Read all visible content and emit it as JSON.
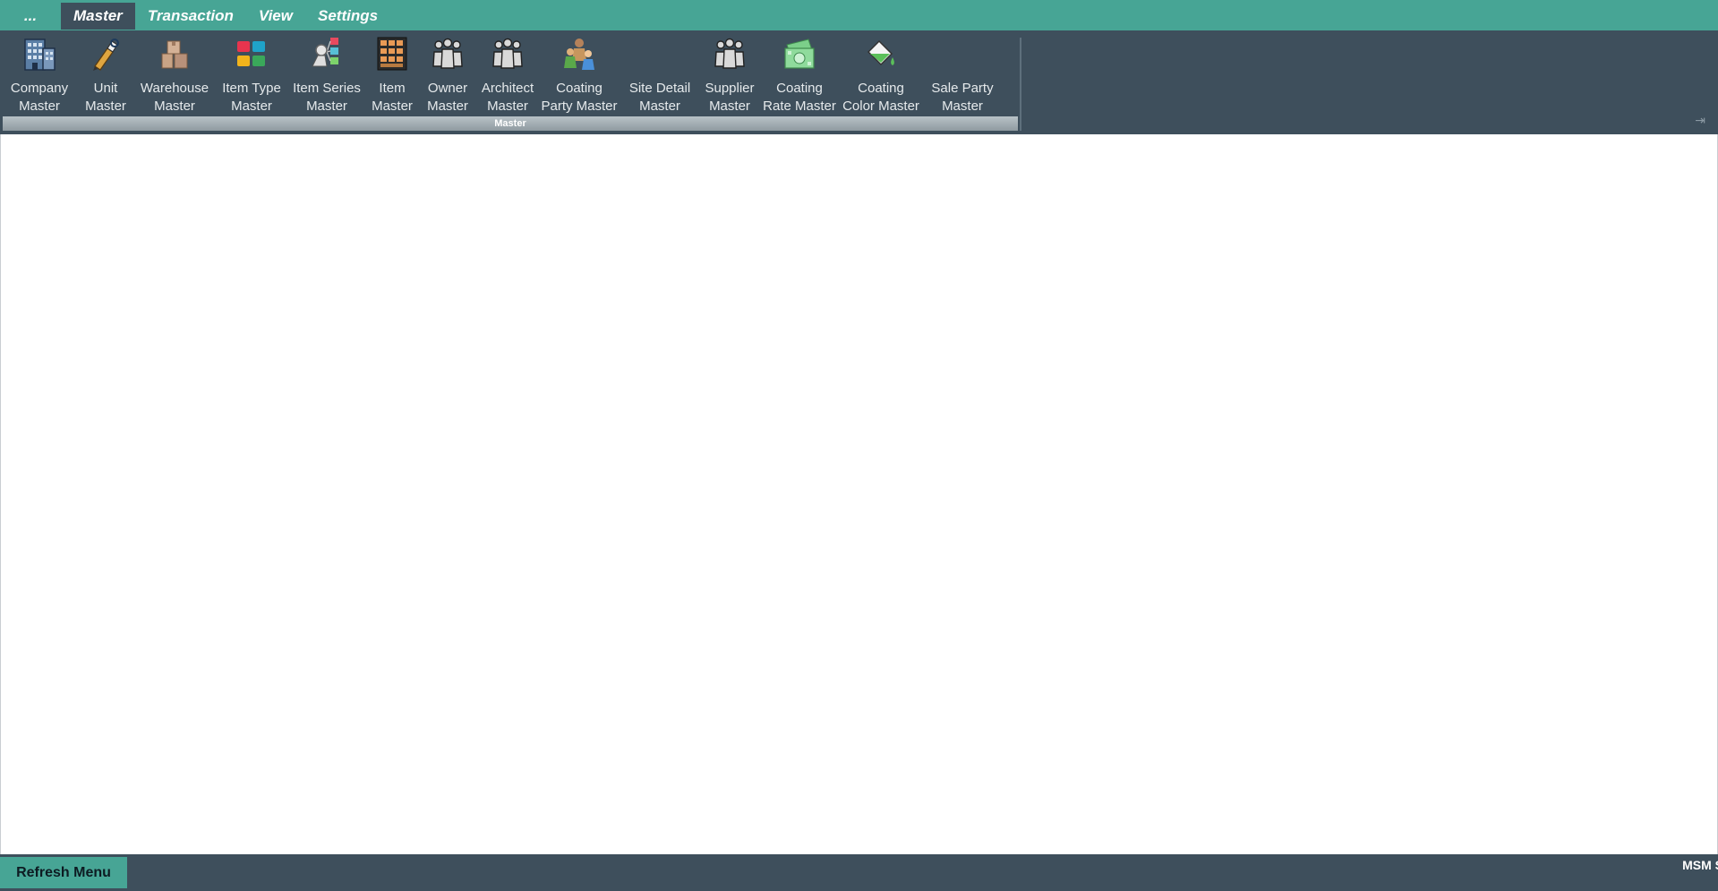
{
  "tabs": [
    {
      "label": "...",
      "name": "tab-app-menu"
    },
    {
      "label": "Master",
      "name": "tab-master",
      "active": true
    },
    {
      "label": "Transaction",
      "name": "tab-transaction"
    },
    {
      "label": "View",
      "name": "tab-view"
    },
    {
      "label": "Settings",
      "name": "tab-settings"
    }
  ],
  "ribbon": {
    "group_caption": "Master",
    "buttons": [
      {
        "label": "Company\nMaster",
        "icon": "building-icon"
      },
      {
        "label": "Unit\nMaster",
        "icon": "pen-tool-icon"
      },
      {
        "label": "Warehouse\nMaster",
        "icon": "warehouse-icon"
      },
      {
        "label": "Item Type\nMaster",
        "icon": "colored-blocks-icon"
      },
      {
        "label": "Item Series\nMaster",
        "icon": "item-series-icon"
      },
      {
        "label": "Item\nMaster",
        "icon": "shelf-icon"
      },
      {
        "label": "Owner\nMaster",
        "icon": "people-group-icon"
      },
      {
        "label": "Architect\nMaster",
        "icon": "people-group-icon"
      },
      {
        "label": "Coating\nParty Master",
        "icon": "party-people-icon"
      },
      {
        "label": "Site Detail\nMaster",
        "icon": "none"
      },
      {
        "label": "Supplier\nMaster",
        "icon": "people-group-icon"
      },
      {
        "label": "Coating\nRate Master",
        "icon": "money-icon"
      },
      {
        "label": "Coating\nColor Master",
        "icon": "paint-bucket-icon"
      },
      {
        "label": "Sale Party\nMaster",
        "icon": "none"
      }
    ]
  },
  "statusbar": {
    "refresh_label": "Refresh Menu",
    "status_text": "MSM S"
  },
  "colors": {
    "accent_teal": "#47a595",
    "ribbon_dark": "#3e4f5c"
  }
}
